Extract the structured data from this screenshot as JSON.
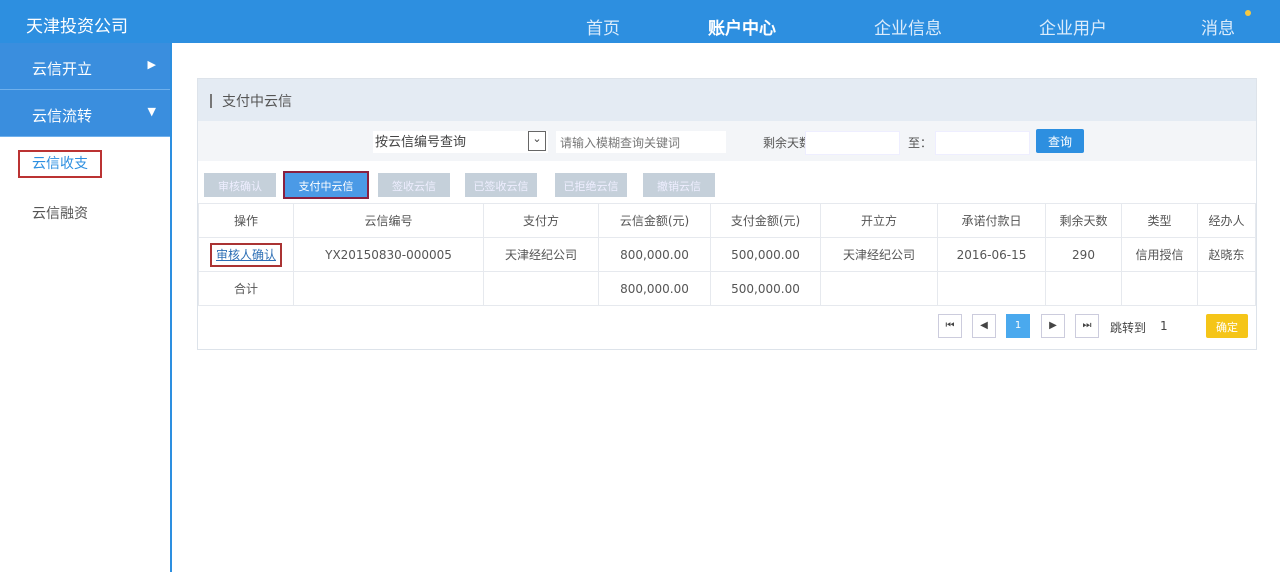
{
  "header": {
    "logo": "天津投资公司",
    "nav": [
      "首页",
      "账户中心",
      "企业信息",
      "企业用户",
      "消息"
    ],
    "active": 1
  },
  "sidebar": {
    "groups": [
      {
        "label": "云信开立",
        "arrow": "▶"
      },
      {
        "label": "云信流转",
        "arrow": "▼"
      }
    ],
    "items": [
      "云信收支",
      "云信融资"
    ]
  },
  "panel": {
    "title": "支付中云信",
    "search": {
      "select": "按云信编号查询",
      "placeholder": "请输入模糊查询关键词",
      "days_label": "剩余天数：",
      "to_label": "至：",
      "query": "查询"
    },
    "buttons": [
      "审核确认",
      "支付中云信",
      "签收云信",
      "已签收云信",
      "已拒绝云信",
      "撤销云信"
    ],
    "columns": [
      "操作",
      "云信编号",
      "支付方",
      "云信金额(元)",
      "支付金额(元)",
      "开立方",
      "承诺付款日",
      "剩余天数",
      "类型",
      "经办人"
    ],
    "rows": [
      [
        "审核人确认",
        "YX20150830-000005",
        "天津经纪公司",
        "800,000.00",
        "500,000.00",
        "天津经纪公司",
        "2016-06-15",
        "290",
        "信用授信",
        "赵晓东"
      ]
    ],
    "total": {
      "label": "合计",
      "amount": "800,000.00",
      "paid": "500,000.00"
    },
    "pagination": {
      "first": "⏮",
      "prev": "◀",
      "current": "1",
      "next": "▶",
      "last": "⏭",
      "jump_label": "跳转到",
      "jump_value": "1",
      "go": "确定"
    }
  }
}
